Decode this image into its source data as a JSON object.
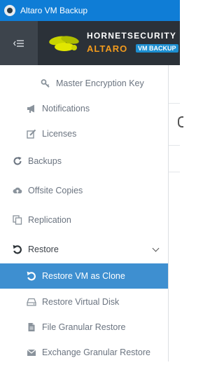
{
  "window": {
    "title": "Altaro VM Backup"
  },
  "header": {
    "brand_line1": "HORNETSECURITY",
    "brand_line2": "ALTARO",
    "brand_badge": "VM BACKUP"
  },
  "sidebar": {
    "items": [
      {
        "label": "Master Encryption Key",
        "icon": "key-icon"
      },
      {
        "label": "Notifications",
        "icon": "megaphone-icon"
      },
      {
        "label": "Licenses",
        "icon": "edit-icon"
      },
      {
        "label": "Backups",
        "icon": "refresh-icon"
      },
      {
        "label": "Offsite Copies",
        "icon": "cloud-upload-icon"
      },
      {
        "label": "Replication",
        "icon": "copy-icon"
      },
      {
        "label": "Restore",
        "icon": "undo-icon",
        "expanded": true
      },
      {
        "label": "Restore VM as Clone",
        "icon": "undo-icon",
        "active": true
      },
      {
        "label": "Restore Virtual Disk",
        "icon": "hard-drive-icon"
      },
      {
        "label": "File Granular Restore",
        "icon": "file-icon"
      },
      {
        "label": "Exchange Granular Restore",
        "icon": "envelope-icon"
      }
    ]
  },
  "colors": {
    "titlebar": "#0f7dd6",
    "header": "#2b3138",
    "active_item": "#3e8fd0",
    "brand_orange": "#f29b1d"
  }
}
